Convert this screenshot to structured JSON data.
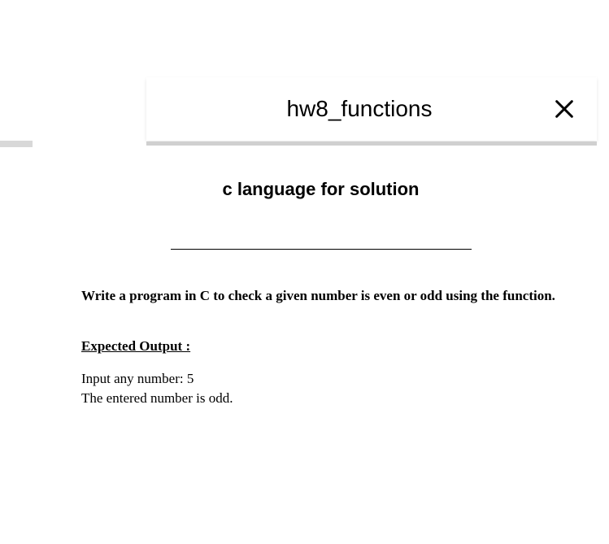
{
  "header": {
    "title": "hw8_functions"
  },
  "content": {
    "subtitle": "c language for solution",
    "problem": "Write a program in C to check a given number is even or odd using the function.",
    "expected_label": "Expected Output :",
    "output_line1": "Input any number: 5",
    "output_line2": "The entered number is odd."
  }
}
